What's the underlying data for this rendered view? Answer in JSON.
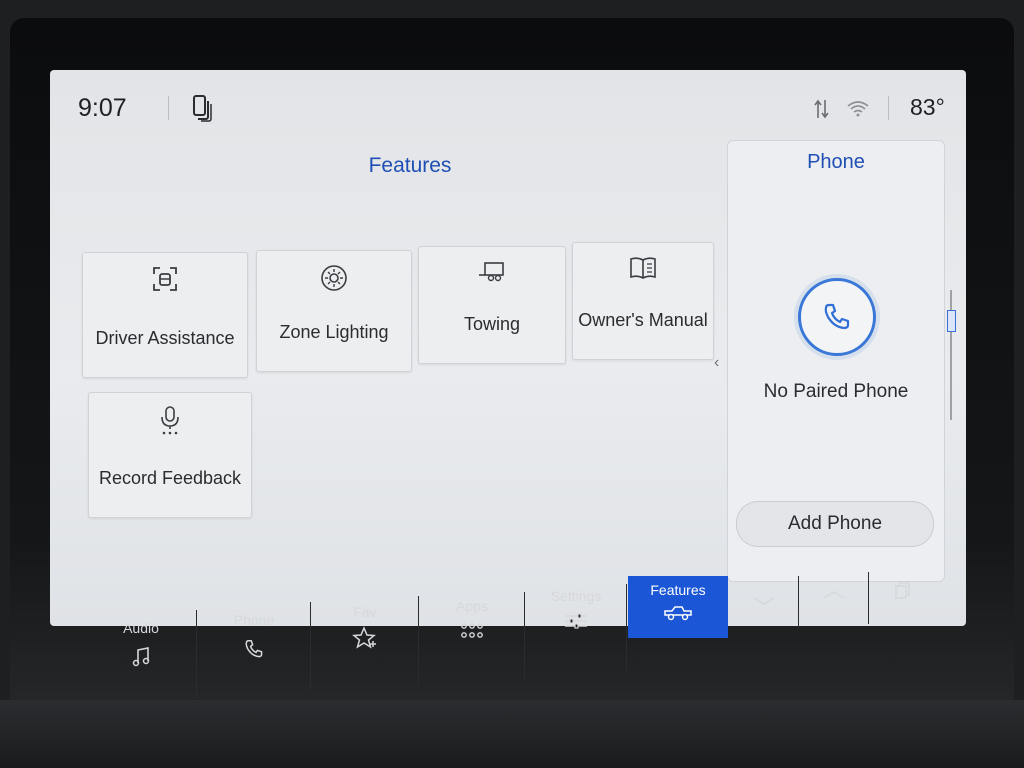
{
  "status_bar": {
    "time": "9:07",
    "temperature": "83°",
    "icons": [
      "phone-status-icon",
      "signal-icon",
      "wifi-icon"
    ]
  },
  "features": {
    "title": "Features",
    "tiles": [
      {
        "label": "Driver Assistance",
        "icon": "driver-assistance-icon"
      },
      {
        "label": "Zone Lighting",
        "icon": "zone-lighting-icon"
      },
      {
        "label": "Towing",
        "icon": "trailer-icon"
      },
      {
        "label": "Owner's Manual",
        "icon": "book-icon"
      },
      {
        "label": "Record Feedback",
        "icon": "microphone-icon"
      }
    ]
  },
  "phone_panel": {
    "title": "Phone",
    "status": "No Paired Phone",
    "add_button": "Add Phone"
  },
  "nav": {
    "items": [
      {
        "label": "Audio",
        "icon": "music-note-icon"
      },
      {
        "label": "Phone",
        "icon": "phone-icon"
      },
      {
        "label": "Fav",
        "icon": "star-icon"
      },
      {
        "label": "Apps",
        "icon": "apps-grid-icon"
      },
      {
        "label": "Settings",
        "icon": "sliders-icon"
      },
      {
        "label": "Features",
        "icon": "truck-icon",
        "active": true
      }
    ],
    "extra_icons": [
      "chevron-down-icon",
      "chevron-up-icon",
      "screens-icon"
    ]
  },
  "colors": {
    "accent": "#1f4fb5",
    "active_tab": "#1b56d6",
    "screen_bg": "#e6e8eb"
  }
}
